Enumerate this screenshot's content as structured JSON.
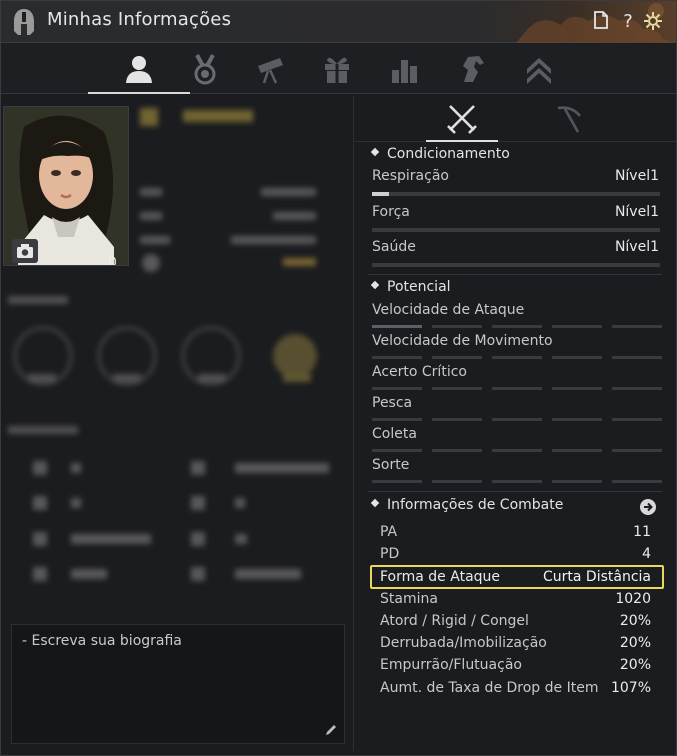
{
  "window": {
    "title": "Minhas Informações"
  },
  "titlebar_buttons": {
    "doc": "document-icon",
    "help": "?",
    "settings": "gear-icon"
  },
  "main_tabs": [
    "profile-icon",
    "medal-icon",
    "telescope-icon",
    "gift-icon",
    "stats-icon",
    "horse-icon",
    "rank-up-icon"
  ],
  "left": {
    "portrait_count": "0",
    "biography_placeholder": "- Escreva sua biografia"
  },
  "conditioning": {
    "header": "Condicionamento",
    "rows": [
      {
        "label": "Respiração",
        "value": "Nível1",
        "progress": 0.06
      },
      {
        "label": "Força",
        "value": "Nível1",
        "progress": 0
      },
      {
        "label": "Saúde",
        "value": "Nível1",
        "progress": 0
      }
    ]
  },
  "potential": {
    "header": "Potencial",
    "rows": [
      {
        "label": "Velocidade de Ataque",
        "level": 1
      },
      {
        "label": "Velocidade de Movimento",
        "level": 0
      },
      {
        "label": "Acerto Crítico",
        "level": 0
      },
      {
        "label": "Pesca",
        "level": 0
      },
      {
        "label": "Coleta",
        "level": 0
      },
      {
        "label": "Sorte",
        "level": 0
      }
    ]
  },
  "combat": {
    "header": "Informações de Combate",
    "rows": [
      {
        "label": "PA",
        "value": "11"
      },
      {
        "label": "PD",
        "value": "4"
      },
      {
        "label": "Forma de Ataque",
        "value": "Curta Distância"
      },
      {
        "label": "Stamina",
        "value": "1020"
      },
      {
        "label": "Atord / Rigid / Congel",
        "value": "20%"
      },
      {
        "label": "Derrubada/Imobilização",
        "value": "20%"
      },
      {
        "label": "Empurrão/Flutuação",
        "value": "20%"
      },
      {
        "label": "Aumt. de Taxa de Drop de Item",
        "value": "107%"
      }
    ]
  },
  "colors": {
    "highlight": "#e9d65a",
    "accent_bar": "#cfcfcf"
  }
}
